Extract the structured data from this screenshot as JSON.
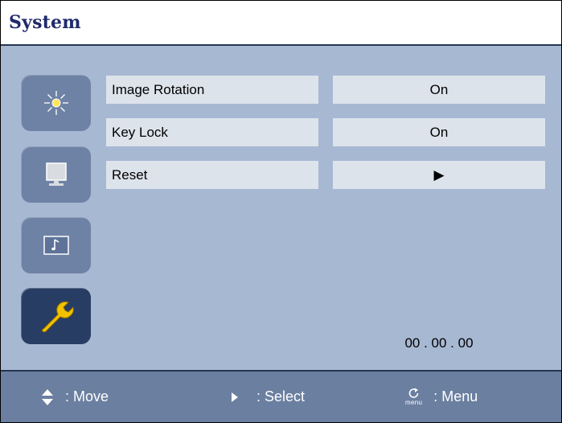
{
  "header": {
    "title": "System"
  },
  "categories": [
    {
      "icon": "brightness-icon",
      "active": false
    },
    {
      "icon": "monitor-icon",
      "active": false
    },
    {
      "icon": "audio-icon",
      "active": false
    },
    {
      "icon": "wrench-icon",
      "active": true
    }
  ],
  "options": [
    {
      "label": "Image Rotation",
      "value": "On"
    },
    {
      "label": "Key Lock",
      "value": "On"
    },
    {
      "label": "Reset",
      "value": "▶"
    }
  ],
  "time": "00 . 00 . 00",
  "footer": {
    "move_label": ": Move",
    "select_label": ": Select",
    "menu_label": ": Menu",
    "menu_icon_text": "menu"
  },
  "colors": {
    "panel": "#a7b8d3",
    "category_button": "#6e82a5",
    "category_active": "#283d63",
    "option_background": "#dde3eb",
    "footer": "#6b7fa0",
    "wrench": "#f2c200",
    "title": "#1f2a6a"
  }
}
